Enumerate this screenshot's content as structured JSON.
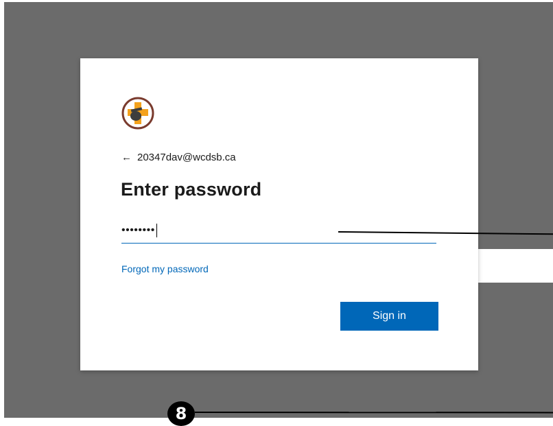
{
  "login": {
    "logo_icon": "school-crest-icon",
    "back_arrow": "←",
    "account_email": "20347dav@wcdsb.ca",
    "heading": "Enter password",
    "password_masked": "••••••••",
    "forgot_link": "Forgot my password",
    "sign_in_label": "Sign in"
  },
  "annotation": {
    "marker_label": "8"
  },
  "colors": {
    "backdrop": "#6b6b6b",
    "accent": "#0067b8",
    "crest_orange": "#f4a21d",
    "crest_brown": "#7a3b2e"
  }
}
